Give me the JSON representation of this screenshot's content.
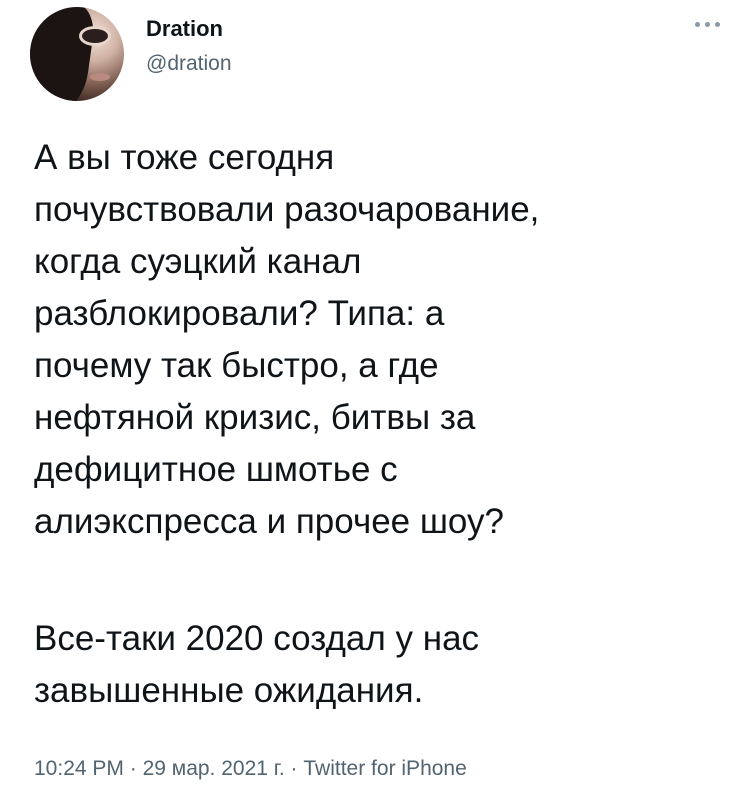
{
  "author": {
    "display_name": "Dration",
    "handle": "@dration"
  },
  "menu": {
    "icon": "more-horizontal-icon"
  },
  "tweet": {
    "paragraph1": [
      "А вы тоже сегодня",
      "почувствовали разочарование,",
      "когда суэцкий канал",
      "разблокировали? Типа: а",
      "почему так быстро, а где",
      "нефтяной кризис, битвы за",
      "дефицитное шмотье с",
      "алиэкспресса и прочее шоу?"
    ],
    "paragraph2": [
      "Все-таки 2020 создал у нас",
      "завышенные ожидания."
    ]
  },
  "meta": {
    "time": "10:24 PM",
    "separator": " · ",
    "date": "29 мар. 2021 г.",
    "source": "Twitter for iPhone"
  },
  "colors": {
    "text": "#0f1419",
    "secondary": "#536471"
  }
}
